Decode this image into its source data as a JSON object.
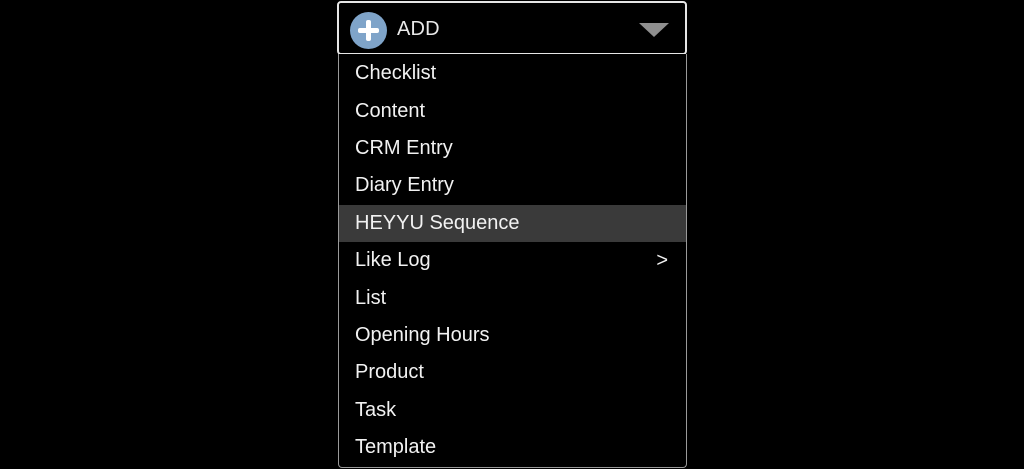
{
  "add_button": {
    "label": "ADD",
    "icon": "plus-circle-icon",
    "caret_icon": "triangle-down-icon"
  },
  "menu": {
    "items": [
      {
        "label": "Checklist",
        "highlighted": false,
        "has_submenu": false
      },
      {
        "label": "Content",
        "highlighted": false,
        "has_submenu": false
      },
      {
        "label": "CRM Entry",
        "highlighted": false,
        "has_submenu": false
      },
      {
        "label": "Diary Entry",
        "highlighted": false,
        "has_submenu": false
      },
      {
        "label": "HEYYU Sequence",
        "highlighted": true,
        "has_submenu": false
      },
      {
        "label": "Like Log",
        "highlighted": false,
        "has_submenu": true,
        "submenu_indicator": ">"
      },
      {
        "label": "List",
        "highlighted": false,
        "has_submenu": false
      },
      {
        "label": "Opening Hours",
        "highlighted": false,
        "has_submenu": false
      },
      {
        "label": "Product",
        "highlighted": false,
        "has_submenu": false
      },
      {
        "label": "Task",
        "highlighted": false,
        "has_submenu": false
      },
      {
        "label": "Template",
        "highlighted": false,
        "has_submenu": false
      }
    ]
  },
  "colors": {
    "background": "#000000",
    "accent_icon": "#7fa4c9",
    "highlight": "#3a3a3a",
    "text": "#f2f2f2",
    "border": "#e6e6e6"
  }
}
